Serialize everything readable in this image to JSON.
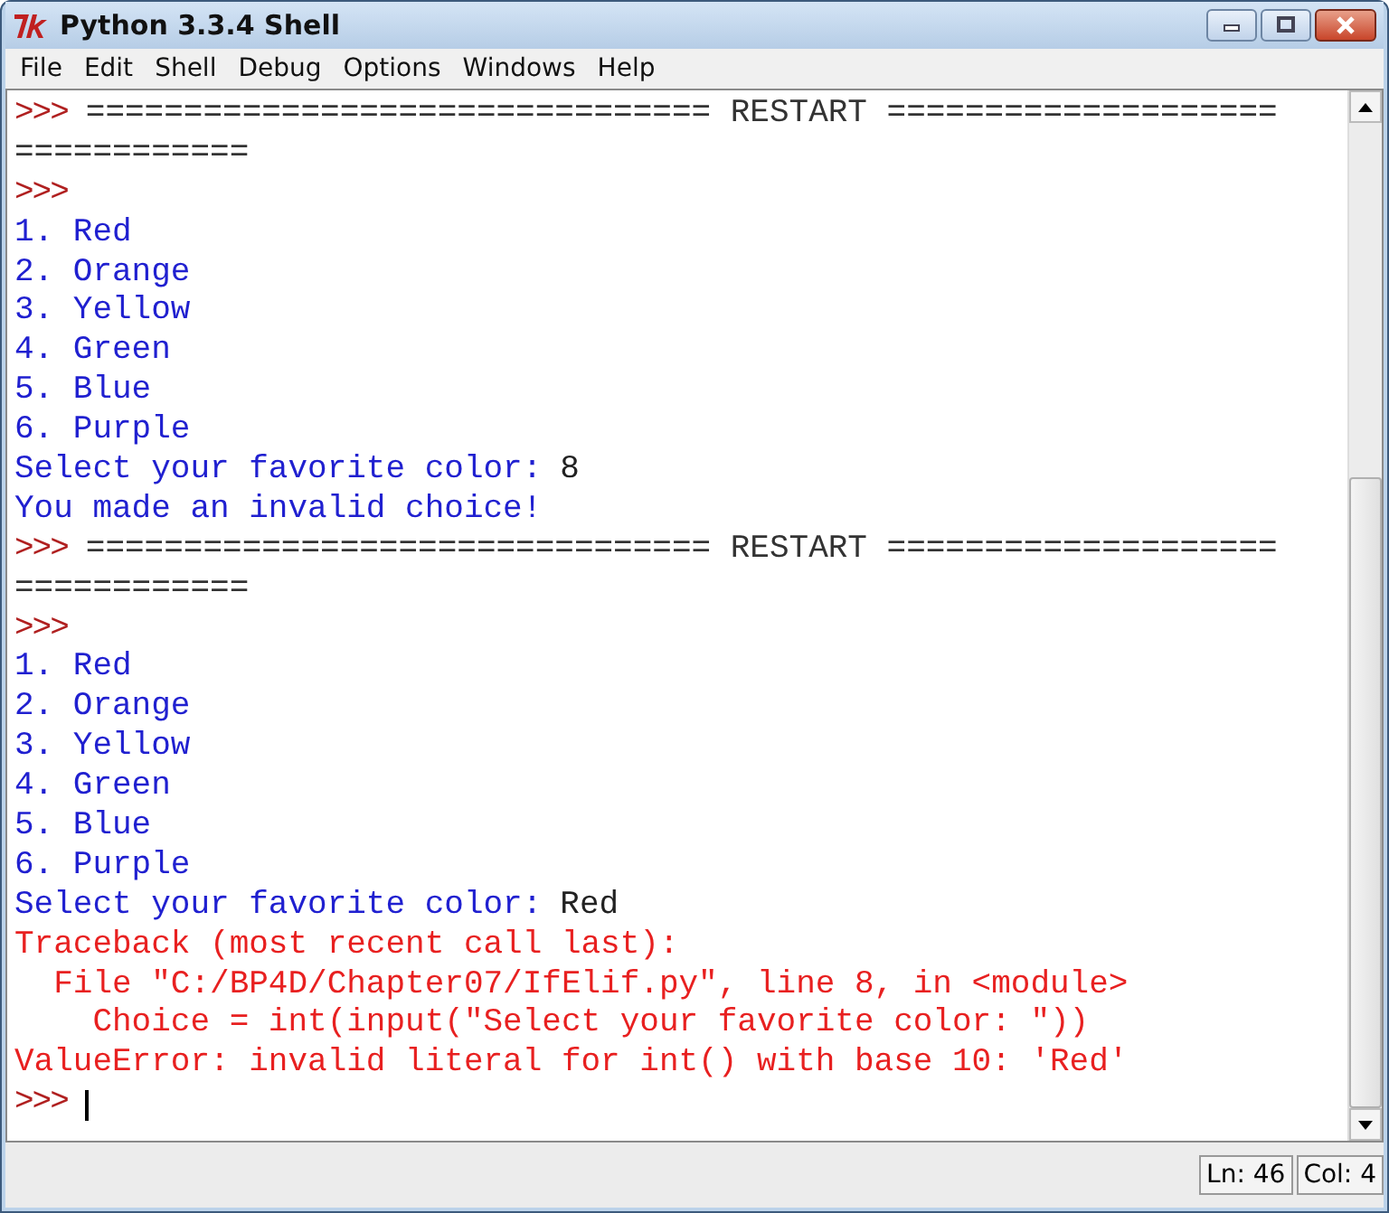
{
  "window": {
    "title": "Python 3.3.4 Shell"
  },
  "menu": [
    {
      "label": "File"
    },
    {
      "label": "Edit"
    },
    {
      "label": "Shell"
    },
    {
      "label": "Debug"
    },
    {
      "label": "Options"
    },
    {
      "label": "Windows"
    },
    {
      "label": "Help"
    }
  ],
  "shell_lines": [
    [
      {
        "kind": "prompt",
        "text": ">>>"
      },
      {
        "kind": "banner",
        "text": "================================ RESTART ===================="
      }
    ],
    [
      {
        "kind": "banner",
        "text": "============"
      }
    ],
    [
      {
        "kind": "prompt",
        "text": ">>>"
      }
    ],
    [
      {
        "kind": "output",
        "text": "1. Red"
      }
    ],
    [
      {
        "kind": "output",
        "text": "2. Orange"
      }
    ],
    [
      {
        "kind": "output",
        "text": "3. Yellow"
      }
    ],
    [
      {
        "kind": "output",
        "text": "4. Green"
      }
    ],
    [
      {
        "kind": "output",
        "text": "5. Blue"
      }
    ],
    [
      {
        "kind": "output",
        "text": "6. Purple"
      }
    ],
    [
      {
        "kind": "output",
        "text": "Select your favorite color:"
      },
      {
        "kind": "input",
        "text": "8"
      }
    ],
    [
      {
        "kind": "output",
        "text": "You made an invalid choice!"
      }
    ],
    [
      {
        "kind": "prompt",
        "text": ">>>"
      },
      {
        "kind": "banner",
        "text": "================================ RESTART ===================="
      }
    ],
    [
      {
        "kind": "banner",
        "text": "============"
      }
    ],
    [
      {
        "kind": "prompt",
        "text": ">>>"
      }
    ],
    [
      {
        "kind": "output",
        "text": "1. Red"
      }
    ],
    [
      {
        "kind": "output",
        "text": "2. Orange"
      }
    ],
    [
      {
        "kind": "output",
        "text": "3. Yellow"
      }
    ],
    [
      {
        "kind": "output",
        "text": "4. Green"
      }
    ],
    [
      {
        "kind": "output",
        "text": "5. Blue"
      }
    ],
    [
      {
        "kind": "output",
        "text": "6. Purple"
      }
    ],
    [
      {
        "kind": "output",
        "text": "Select your favorite color:"
      },
      {
        "kind": "input",
        "text": "Red"
      }
    ],
    [
      {
        "kind": "error",
        "text": "Traceback (most recent call last):"
      }
    ],
    [
      {
        "kind": "error",
        "text": "  File \"C:/BP4D/Chapter07/IfElif.py\", line 8, in <module>"
      }
    ],
    [
      {
        "kind": "error",
        "text": "    Choice = int(input(\"Select your favorite color: \"))"
      }
    ],
    [
      {
        "kind": "error",
        "text": "ValueError: invalid literal for int() with base 10: 'Red'"
      }
    ],
    [
      {
        "kind": "prompt",
        "text": ">>>"
      },
      {
        "kind": "cursor"
      }
    ]
  ],
  "status_bar": {
    "line": "Ln: 46",
    "column": "Col: 4"
  }
}
